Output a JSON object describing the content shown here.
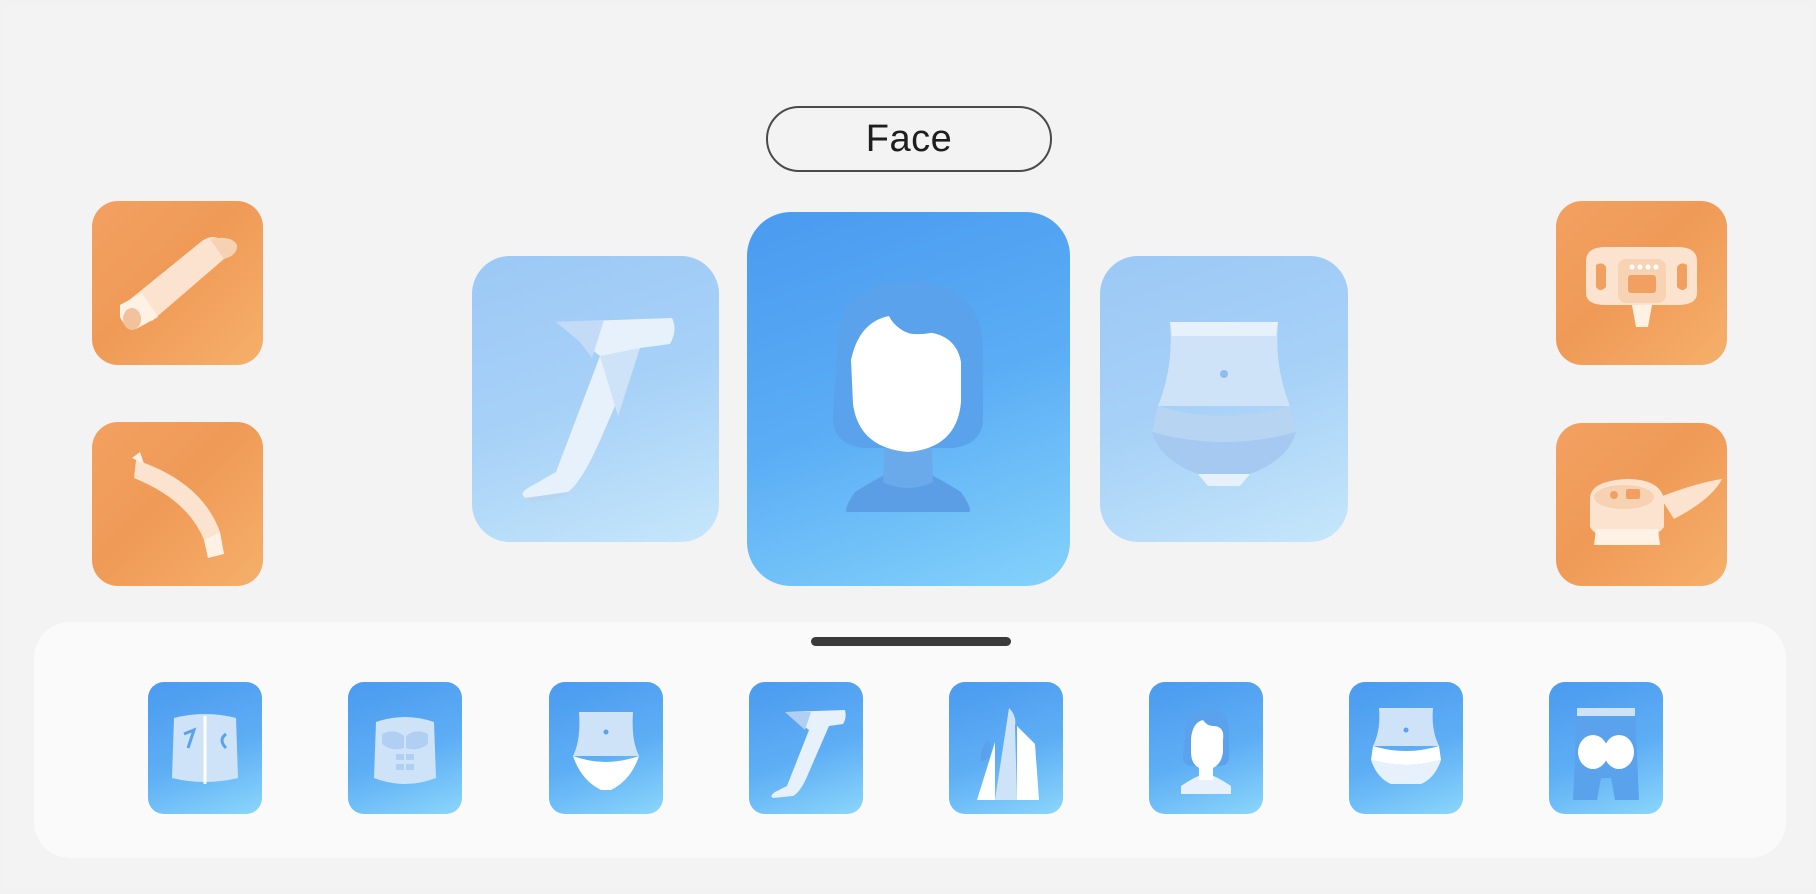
{
  "header": {
    "selected_title": "Face"
  },
  "carousel": {
    "left_item": "leg-icon",
    "center_item": "face-icon",
    "right_item": "abdomen-icon"
  },
  "devices": {
    "left": [
      "handpiece-icon",
      "curved-handpiece-icon"
    ],
    "right": [
      "belt-applicator-icon",
      "saddle-applicator-icon"
    ]
  },
  "tray": {
    "thumbnails": [
      "back-icon",
      "chest-icon",
      "lower-abdomen-icon",
      "leg-icon",
      "flame-icon",
      "face-icon",
      "waist-icon",
      "buttocks-icon"
    ]
  },
  "colors": {
    "accent_blue": "#4a9af0",
    "light_blue": "#a7d1f7",
    "device_orange": "#f09a57",
    "pill_border": "#4a4a4a"
  }
}
